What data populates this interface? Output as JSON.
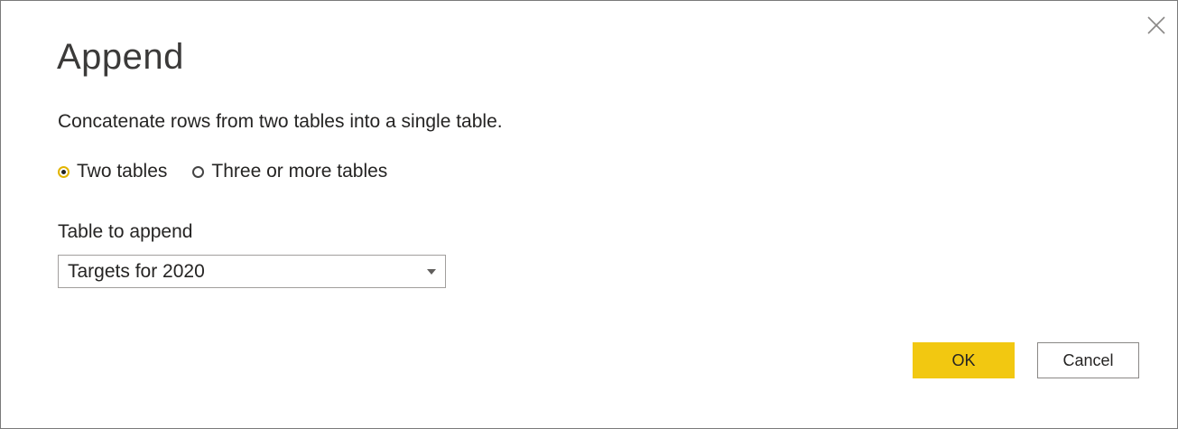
{
  "dialog": {
    "title": "Append",
    "description": "Concatenate rows from two tables into a single table.",
    "close_icon": "close-icon"
  },
  "mode": {
    "options": [
      {
        "label": "Two tables",
        "selected": true
      },
      {
        "label": "Three or more tables",
        "selected": false
      }
    ]
  },
  "table_to_append": {
    "label": "Table to append",
    "selected_value": "Targets for 2020",
    "arrow_icon": "chevron-down-icon"
  },
  "buttons": {
    "ok_label": "OK",
    "cancel_label": "Cancel"
  },
  "colors": {
    "accent": "#f2c811",
    "text": "#252423",
    "border": "#a19f9d"
  }
}
